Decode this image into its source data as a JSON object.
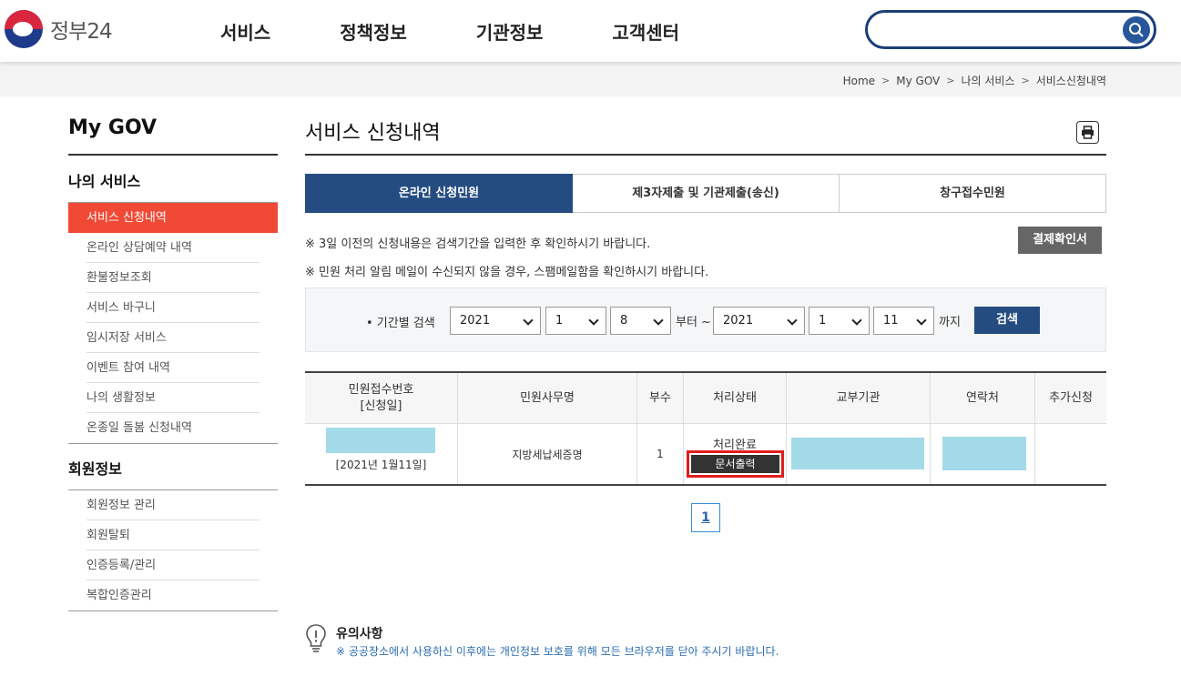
{
  "header": {
    "logo_text": "정부24",
    "nav": [
      "서비스",
      "정책정보",
      "기관정보",
      "고객센터"
    ],
    "search_value": ""
  },
  "breadcrumb": [
    "Home",
    "My GOV",
    "나의 서비스",
    "서비스신청내역"
  ],
  "sidebar": {
    "title": "My GOV",
    "section1": "나의 서비스",
    "items1": [
      "서비스 신청내역",
      "온라인 상담예약 내역",
      "환불정보조회",
      "서비스 바구니",
      "임시저장 서비스",
      "이벤트 참여 내역",
      "나의 생활정보",
      "온종일 돌봄 신청내역"
    ],
    "section2": "회원정보",
    "items2": [
      "회원정보 관리",
      "회원탈퇴",
      "인증등록/관리",
      "복합인증관리"
    ]
  },
  "main": {
    "title": "서비스 신청내역",
    "tabs": [
      "온라인 신청민원",
      "제3자제출 및 기관제출(송신)",
      "창구접수민원"
    ],
    "notice1": "※ 3일 이전의 신청내용은 검색기간을 입력한 후 확인하시기 바랍니다.",
    "notice2": "※ 민원 처리 알림 메일이 수신되지 않을 경우, 스팸메일함을 확인하시기 바랍니다.",
    "pay_button": "결제확인서",
    "search": {
      "label": "• 기간별 검색",
      "from_year": "2021",
      "from_month": "1",
      "from_day": "8",
      "from_text": "부터 ~",
      "to_year": "2021",
      "to_month": "1",
      "to_day": "11",
      "to_text": "까지",
      "button": "검색"
    },
    "table": {
      "headers": [
        "민원접수번호\n[신청일]",
        "민원사무명",
        "부수",
        "처리상태",
        "교부기관",
        "연락처",
        "추가신청"
      ],
      "header0_line1": "민원접수번호",
      "header0_line2": "[신청일]",
      "row": {
        "date": "[2021년 1월11일]",
        "name": "지방세납세증명",
        "count": "1",
        "status": "처리완료",
        "print_button": "문서출력"
      }
    },
    "page": "1"
  },
  "caution": {
    "title": "유의사항",
    "text": "※ 공공장소에서 사용하신 이후에는 개인정보 보호를 위해 모든 브라우저를 닫아 주시기 바랍니다."
  }
}
